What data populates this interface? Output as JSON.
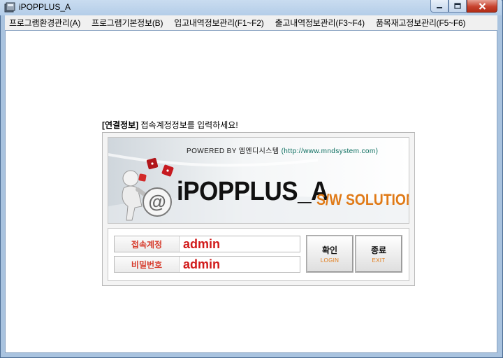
{
  "window": {
    "title": "iPOPPLUS_A"
  },
  "menu": [
    "프로그램환경관리(A)",
    "프로그램기본정보(B)",
    "입고내역정보관리(F1~F2)",
    "출고내역정보관리(F3~F4)",
    "품목재고정보관리(F5~F6)"
  ],
  "connection": {
    "heading": "[연결정보]",
    "prompt": "접속계정정보를 입력하세요!"
  },
  "banner": {
    "powered_by": "POWERED BY 엠엔디시스템",
    "url": "(http://www.mndsystem.com)",
    "brand": "iPOPPLUS_A",
    "slogan": "S/W SOLUTION"
  },
  "form": {
    "account_label": "접속계정",
    "account_value": "admin",
    "password_label": "비밀번호",
    "password_value": "admin"
  },
  "buttons": {
    "ok_label": "확인",
    "ok_sub": "LOGIN",
    "exit_label": "종료",
    "exit_sub": "EXIT"
  },
  "colors": {
    "label_red": "#d63a2b",
    "value_red": "#d11a1a",
    "accent_orange": "#e07a17",
    "url_teal": "#0a6d5e"
  },
  "icons": [
    "app-icon",
    "minimize-icon",
    "maximize-icon",
    "close-icon",
    "mascot-logo",
    "dice-icon"
  ]
}
